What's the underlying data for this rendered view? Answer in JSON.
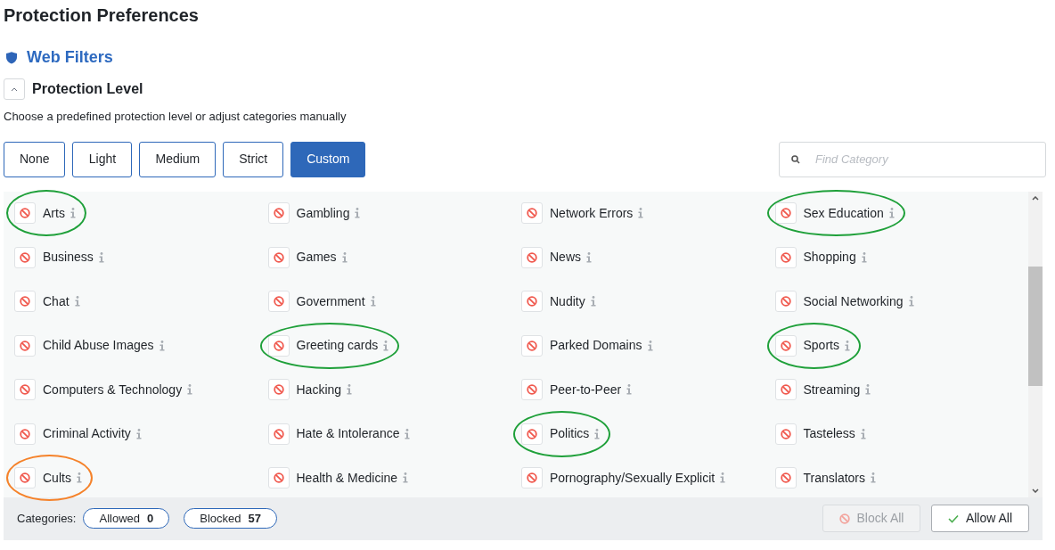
{
  "page_title": "Protection Preferences",
  "section": {
    "title": "Web Filters"
  },
  "subsection": {
    "title": "Protection Level",
    "expanded": true
  },
  "description": "Choose a predefined protection level or adjust categories manually",
  "levels": [
    {
      "label": "None",
      "selected": false
    },
    {
      "label": "Light",
      "selected": false
    },
    {
      "label": "Medium",
      "selected": false
    },
    {
      "label": "Strict",
      "selected": false
    },
    {
      "label": "Custom",
      "selected": true
    }
  ],
  "search": {
    "placeholder": "Find Category"
  },
  "category_columns": [
    [
      {
        "name": "Arts",
        "blocked": true,
        "color": "#1fa03a"
      },
      {
        "name": "Business",
        "blocked": true
      },
      {
        "name": "Chat",
        "blocked": true
      },
      {
        "name": "Child Abuse Images",
        "blocked": true
      },
      {
        "name": "Computers & Technology",
        "blocked": true
      },
      {
        "name": "Criminal Activity",
        "blocked": true
      },
      {
        "name": "Cults",
        "blocked": true,
        "color": "#f5822a"
      }
    ],
    [
      {
        "name": "Gambling",
        "blocked": true
      },
      {
        "name": "Games",
        "blocked": true
      },
      {
        "name": "Government",
        "blocked": true
      },
      {
        "name": "Greeting cards",
        "blocked": true,
        "color": "#1fa03a"
      },
      {
        "name": "Hacking",
        "blocked": true
      },
      {
        "name": "Hate & Intolerance",
        "blocked": true
      },
      {
        "name": "Health & Medicine",
        "blocked": true
      }
    ],
    [
      {
        "name": "Network Errors",
        "blocked": true
      },
      {
        "name": "News",
        "blocked": true
      },
      {
        "name": "Nudity",
        "blocked": true
      },
      {
        "name": "Parked Domains",
        "blocked": true
      },
      {
        "name": "Peer-to-Peer",
        "blocked": true
      },
      {
        "name": "Politics",
        "blocked": true,
        "color": "#1fa03a"
      },
      {
        "name": "Pornography/Sexually Explicit",
        "blocked": true
      }
    ],
    [
      {
        "name": "Sex Education",
        "blocked": true,
        "color": "#1fa03a"
      },
      {
        "name": "Shopping",
        "blocked": true
      },
      {
        "name": "Social Networking",
        "blocked": true
      },
      {
        "name": "Sports",
        "blocked": true,
        "color": "#1fa03a"
      },
      {
        "name": "Streaming",
        "blocked": true
      },
      {
        "name": "Tasteless",
        "blocked": true
      },
      {
        "name": "Translators",
        "blocked": true
      }
    ]
  ],
  "footer": {
    "label": "Categories:",
    "counts": [
      {
        "label": "Allowed",
        "value": "0"
      },
      {
        "label": "Blocked",
        "value": "57"
      }
    ],
    "buttons": [
      {
        "kind": "block",
        "label": "Block All",
        "disabled": true
      },
      {
        "kind": "allow",
        "label": "Allow All",
        "disabled": false
      }
    ]
  }
}
